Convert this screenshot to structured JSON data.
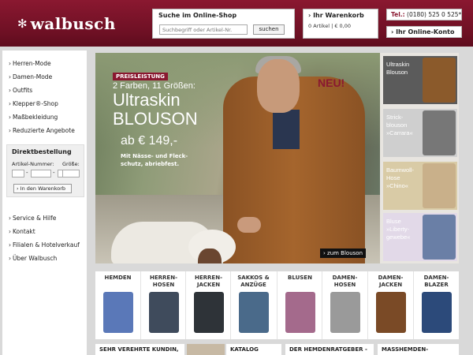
{
  "header": {
    "logo_symbol": "✻",
    "logo_text": "walbusch",
    "search_title": "Suche im Online-Shop",
    "search_placeholder": "Suchbegriff oder Artikel-Nr.",
    "search_button": "suchen",
    "cart_title": "› Ihr Warenkorb",
    "cart_summary": "0 Artikel | € 0,00",
    "tel_label": "Tel.:",
    "tel_number": " (0180) 525 0 525*",
    "account_label": "› Ihr Online-Konto"
  },
  "sidebar": {
    "nav_top": [
      "Herren-Mode",
      "Damen-Mode",
      "Outfits",
      "Klepper®-Shop",
      "Maßbekleidung",
      "Reduzierte Angebote"
    ],
    "direct": {
      "title": "Direktbestellung",
      "label_article": "Artikel-Nummer:",
      "label_size": "Größe:",
      "button": "› In den Warenkorb"
    },
    "nav_bottom": [
      "Service & Hilfe",
      "Kontakt",
      "Filialen & Hotelverkauf",
      "Über Walbusch"
    ]
  },
  "hero": {
    "badge": "PREISLEISTUNG",
    "subtitle": "2 Farben, 11 Größen:",
    "title_line1": "Ultraskin",
    "title_line2": "BLOUSON",
    "price": "ab € 149,-",
    "note": "Mit Nässe- und Fleck-schutz, abriebfest.",
    "neu": "NEU!",
    "cta": "› zum Blouson"
  },
  "tiles": [
    {
      "label": "Ultraskin Blouson",
      "bg": "#5b5b5b",
      "pic": "#8b5a2b"
    },
    {
      "label": "Strick-blouson »Carrara«",
      "bg": "#cfcfcf",
      "pic": "#777777"
    },
    {
      "label": "Baumwoll-Hose »Chino«",
      "bg": "#d9cba6",
      "pic": "#c9b08a"
    },
    {
      "label": "Bluse »Liberty-gewebe«",
      "bg": "#e2d9e8",
      "pic": "#6a7fa6"
    }
  ],
  "categories": [
    {
      "name": "HEMDEN",
      "color": "#5a78b8"
    },
    {
      "name": "HERREN-HOSEN",
      "color": "#3f4b5c"
    },
    {
      "name": "HERREN-JACKEN",
      "color": "#2e3338"
    },
    {
      "name": "SAKKOS & ANZÜGE",
      "color": "#4a6a8a"
    },
    {
      "name": "BLUSEN",
      "color": "#a46a8c"
    },
    {
      "name": "DAMEN-HOSEN",
      "color": "#9a9a9a"
    },
    {
      "name": "DAMEN-JACKEN",
      "color": "#7a4a26"
    },
    {
      "name": "DAMEN-BLAZER",
      "color": "#2c4a7a"
    }
  ],
  "promos": [
    "SEHR VEREHRTE KUNDIN,",
    "KATALOG",
    "DER HEMDENRATGEBER -",
    "MASSHEMDEN-"
  ]
}
